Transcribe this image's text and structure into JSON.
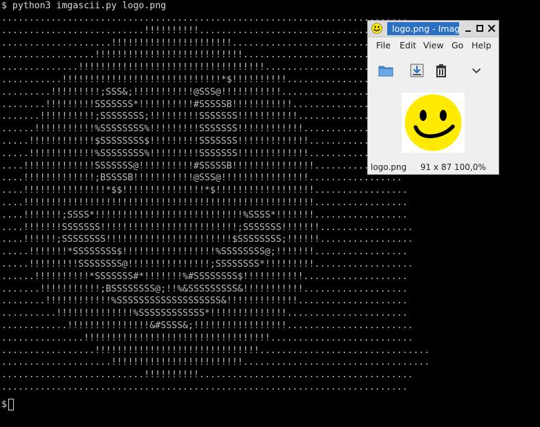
{
  "terminal": {
    "prompt_symbol": "$",
    "command": "python3 imgascii.py logo.png",
    "bottom_prompt": "$",
    "ascii_art": [
      "..........................................................................",
      "..........................!!!!!!!!!!.......................................",
      "....................!!!!!!!!!!!!!!!!!!!!!!..................................",
      ".................!!!!!!!!!!!!!!!!!!!!!!!!!!!.............................",
      "..............!!!!!!!!!!!!!!!!!!!!!!!!!!!!!!!!!!..........................",
      "...........!!!!!!!!!!!!!!!!!!!!!!!!!!!!!*$!!!!!!!!!!........................",
      ".........!!!!!!!!!;SSS&;!!!!!!!!!!!@SSS@!!!!!!!!!!!.......................",
      "........!!!!!!!!!SSSSSSS*!!!!!!!!!!#SSSSSB!!!!!!!!!!!.....................",
      ".......!!!!!!!!!!;SSSSSSSS;!!!!!!!!!SSSSSSS!!!!!!!!!!!....................",
      "......!!!!!!!!!!!%SSSSSSSS%!!!!!!!!!SSSSSSS!!!!!!!!!!!!...................",
      ".....!!!!!!!!!!!!$SSSSSSSS$!!!!!!!!!SSSSSSS!!!!!!!!!!!!!..................",
      ".....!!!!!!!!!!!!%SSSSSSSS%!!!!!!!!!SSSSSSS!!!!!!!!!!!!!..................",
      "....!!!!!!!!!!!!!SSSSSSS@!!!!!!!!!!#SSSSSB!!!!!!!!!!!!!!!.................",
      "....!!!!!!!!!!!!!;BSSSSB!!!!!!!!!!!@SSS@!!!!!!!!!!!!!!!!.................",
      "....!!!!!!!!!!!!!!!*$$!!!!!!!!!!!!!!!*$!!!!!!!!!!!!!!!!!!.................",
      "....!!!!!!!!!!!!!!!!!!!!!!!!!!!!!!!!!!!!!!!!!!!!!!!!!!!!!.................",
      "....!!!!!!!;SSSS*!!!!!!!!!!!!!!!!!!!!!!!!!!!%SSSS*!!!!!!!.................",
      "....!!!!!!!SSSSSSS!!!!!!!!!!!!!!!!!!!!!!!!!;SSSSSSS!!!!!!!.................",
      "....!!!!!!;SSSSSSSS!!!!!!!!!!!!!!!!!!!!!!!$SSSSSSSS;!!!!!!.................",
      ".....!!!!!!!*SSSSSSSS$!!!!!!!!!!!!!!!!!%SSSSSSSS@;!!!!!!!.................",
      ".....!!!!!!!!!SSSSSSSS@!!!!!!!!!!!!!!!;SSSSSSSS*!!!!!!!!!..................",
      "......!!!!!!!!!!*SSSSSSS#*!!!!!!!%#SSSSSSSS$!!!!!!!!!!!...................",
      ".......!!!!!!!!!!!;BSSSSSSSS@;!!%&SSSSSSSSS&!!!!!!!!!!!...................",
      "........!!!!!!!!!!!!%SSSSSSSSSSSSSSSSSSS&!!!!!!!!!!!!!....................",
      "..........!!!!!!!!!!!!!!%SSSSSSSSSSSS*!!!!!!!!!!!!!!......................",
      "............!!!!!!!!!!!!!!!&#SSSS&;!!!!!!!!!!!!!!!!!.......................",
      "...............!!!!!!!!!!!!!!!!!!!!!!!!!!!!!!!!!!..........................",
      ".................!!!!!!!!!!!!!!!!!!!!!!!!!!!!!!...............................",
      "....................!!!!!!!!!!!!!!!!!!!!!!!!..................................",
      "..........................!!!!!!!!!!.......................................",
      ".........................................................................."
    ]
  },
  "viewer": {
    "title": "logo.png - Image Viewer",
    "menu": [
      "File",
      "Edit",
      "View",
      "Go",
      "Help"
    ],
    "toolbar": {
      "open": "folder-icon",
      "save": "save-icon",
      "delete": "trash-icon",
      "more": "chevron-down-icon"
    },
    "status": {
      "filename": "logo.png",
      "dimensions": "91 x 87",
      "zoom": "100,0%"
    },
    "image_subject": "smiley-face",
    "colors": {
      "title_active": "#2c70c4",
      "smiley_face": "#ffeb00",
      "smiley_features": "#000000"
    }
  }
}
